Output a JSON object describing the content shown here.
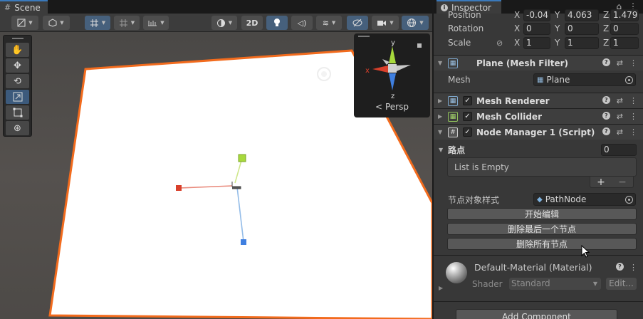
{
  "scene": {
    "tab_label": "Scene",
    "toolbar": {
      "mode_2d": "2D"
    },
    "gizmo": {
      "projection": "Persp",
      "axis_x": "x",
      "axis_y": "y",
      "axis_z": "z"
    },
    "tools": [
      "hand",
      "move",
      "rotate",
      "scale",
      "rect",
      "transform"
    ]
  },
  "inspector": {
    "tab_label": "Inspector",
    "transform": {
      "position_label": "Position",
      "position": {
        "x": "-0.04",
        "y": "4.063",
        "z": "1.479"
      },
      "rotation_label": "Rotation",
      "rotation": {
        "x": "0",
        "y": "0",
        "z": "0"
      },
      "scale_label": "Scale",
      "scale": {
        "x": "1",
        "y": "1",
        "z": "1"
      },
      "axis_x": "X",
      "axis_y": "Y",
      "axis_z": "Z"
    },
    "mesh_filter": {
      "title": "Plane (Mesh Filter)",
      "mesh_label": "Mesh",
      "mesh_value": "Plane"
    },
    "mesh_renderer": {
      "title": "Mesh Renderer"
    },
    "mesh_collider": {
      "title": "Mesh Collider"
    },
    "node_manager": {
      "title": "Node Manager 1 (Script)",
      "path_label": "路点",
      "path_count": "0",
      "list_empty": "List is Empty",
      "plus": "+",
      "minus": "−",
      "node_style_label": "节点对象样式",
      "node_style_value": "PathNode",
      "btn_start_edit": "开始编辑",
      "btn_delete_last": "删除最后一个节点",
      "btn_delete_all": "删除所有节点"
    },
    "material": {
      "name": "Default-Material (Material)",
      "shader_label": "Shader",
      "shader_value": "Standard",
      "edit_label": "Edit..."
    },
    "add_component": "Add Component"
  },
  "colors": {
    "selection_outline": "#f26b1d",
    "plane_fill": "#ffffff",
    "x_axis": "#d9402b",
    "y_axis": "#a7d93c",
    "z_axis": "#3f7fe0",
    "active_tab_accent": "#3a79bb"
  }
}
